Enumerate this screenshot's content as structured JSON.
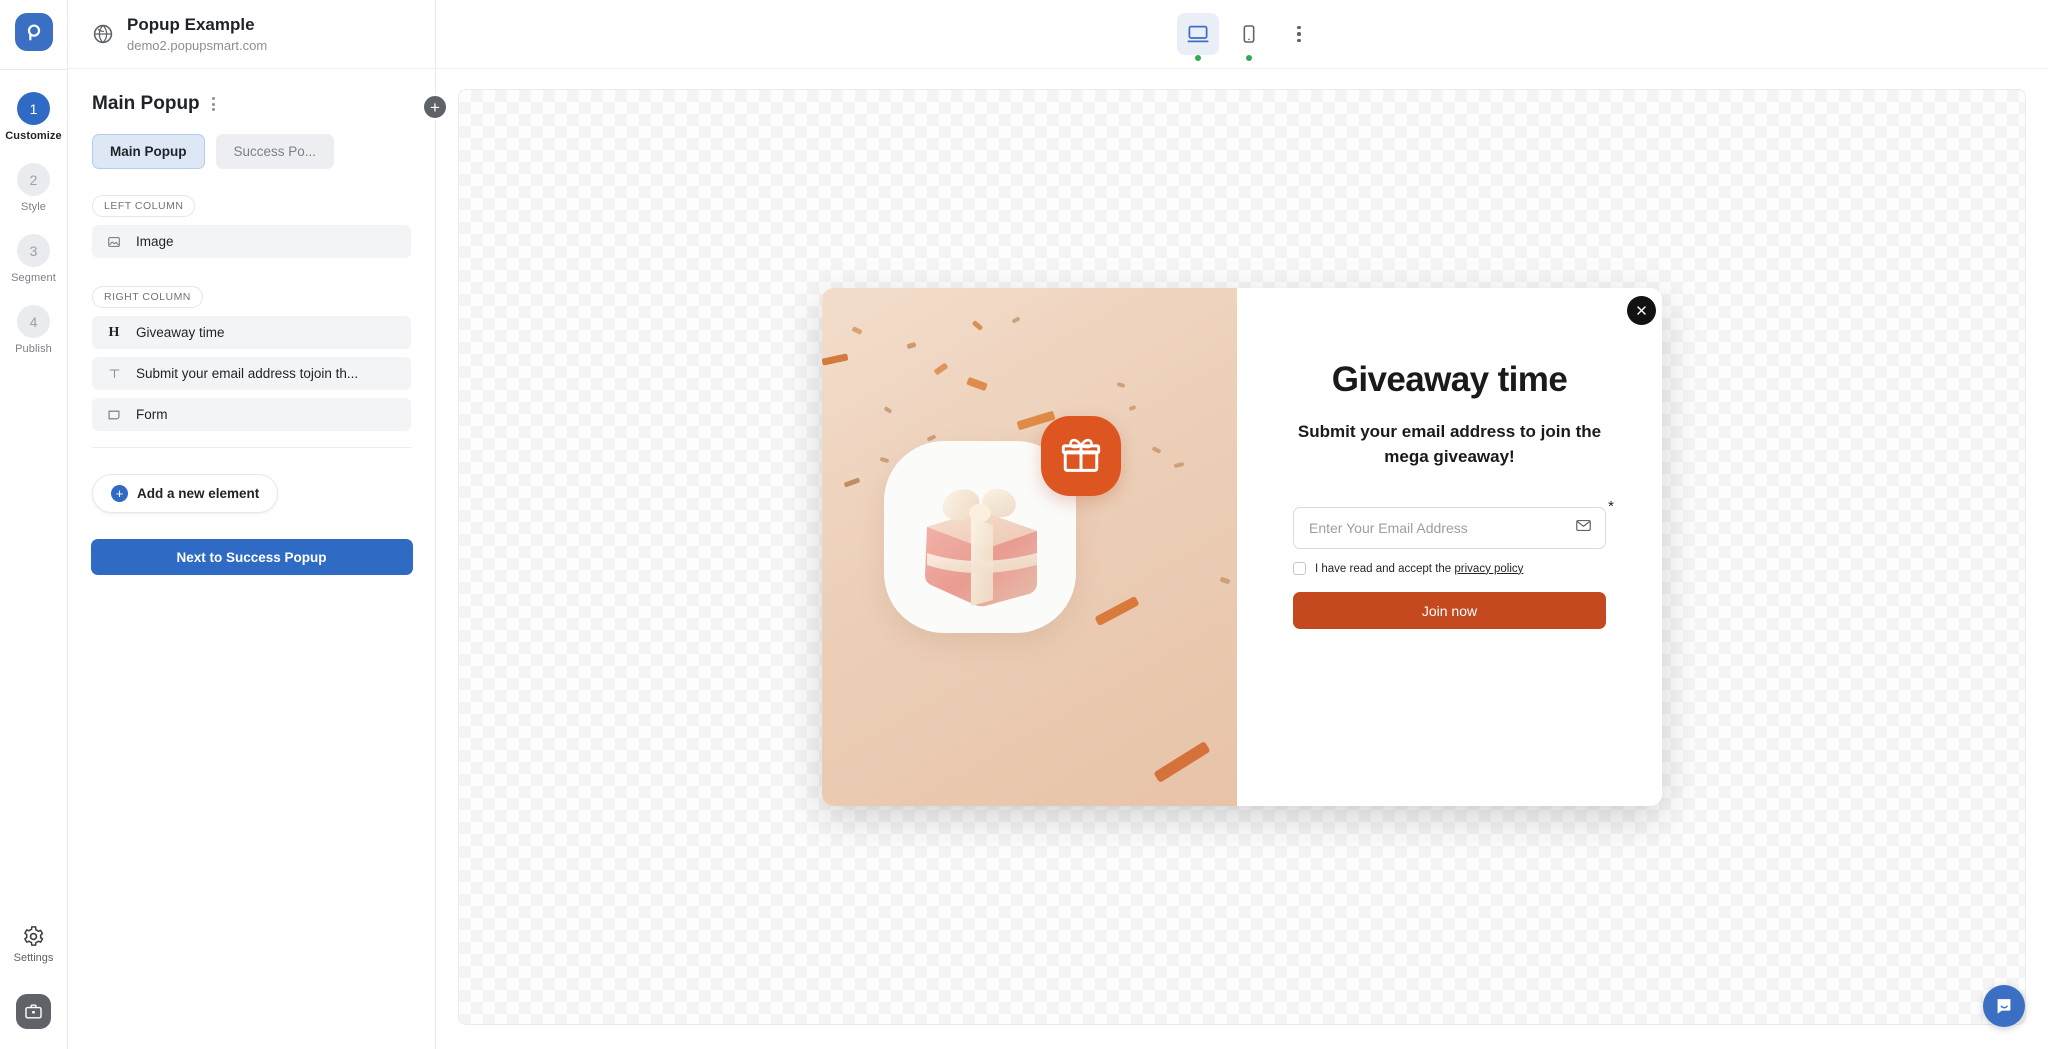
{
  "rail": {
    "logo_icon": "popupsmart-logo-icon",
    "steps": [
      {
        "num": "1",
        "label": "Customize",
        "active": true
      },
      {
        "num": "2",
        "label": "Style",
        "active": false
      },
      {
        "num": "3",
        "label": "Segment",
        "active": false
      },
      {
        "num": "4",
        "label": "Publish",
        "active": false
      }
    ],
    "settings_label": "Settings",
    "settings_icon": "gear-icon",
    "briefcase_icon": "briefcase-icon"
  },
  "panel": {
    "globe_icon": "globe-icon",
    "site_title": "Popup Example",
    "site_url": "demo2.popupsmart.com",
    "heading": "Main Popup",
    "kebab_icon": "more-vertical-icon",
    "add_round_label": "+",
    "tabs": [
      {
        "label": "Main Popup",
        "active": true
      },
      {
        "label": "Success Po...",
        "active": false
      }
    ],
    "left_column_badge": "LEFT COLUMN",
    "right_column_badge": "RIGHT COLUMN",
    "left_elements": [
      {
        "icon": "image-icon",
        "icon_glyph": "image",
        "label": "Image"
      }
    ],
    "right_elements": [
      {
        "icon": "heading-icon",
        "icon_glyph": "H",
        "label": "Giveaway time"
      },
      {
        "icon": "text-icon",
        "icon_glyph": "T",
        "label": "Submit your email address tojoin th..."
      },
      {
        "icon": "form-icon",
        "icon_glyph": "form",
        "label": "Form"
      }
    ],
    "add_element_label": "Add a new element",
    "next_button_label": "Next to Success Popup"
  },
  "topbar": {
    "desktop_icon": "desktop-icon",
    "mobile_icon": "mobile-icon",
    "kebab_icon": "more-vertical-icon",
    "desktop_active": true,
    "status_color": "#34a853"
  },
  "popup": {
    "close_icon": "close-icon",
    "gift_badge_icon": "gift-icon",
    "gift_image_icon": "gift-box-illustration",
    "title": "Giveaway time",
    "subtitle": "Submit your email address to join the mega giveaway!",
    "email_placeholder": "Enter Your Email Address",
    "email_value": "",
    "mail_icon": "envelope-icon",
    "required_marker": "*",
    "consent_prefix": "I have read and accept the ",
    "consent_link": "privacy policy",
    "submit_label": "Join now",
    "submit_color": "#c4491f",
    "badge_color": "#dd5521"
  },
  "chat": {
    "icon": "chat-bubble-icon",
    "color": "#3b6fc4"
  }
}
